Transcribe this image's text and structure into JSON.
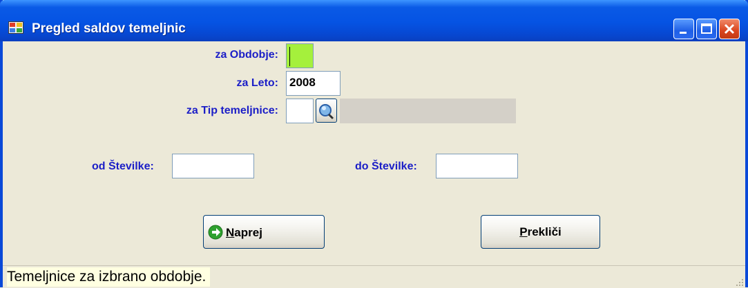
{
  "window": {
    "title": "Pregled saldov temeljnic",
    "minimize_label": "_",
    "maximize_label": "□",
    "close_label": "X"
  },
  "form": {
    "obdobje": {
      "label": "za Obdobje:",
      "value": ""
    },
    "leto": {
      "label": "za Leto:",
      "value": "2008"
    },
    "tip": {
      "label": "za Tip temeljnice:",
      "value": "",
      "description": ""
    },
    "od": {
      "label": "od Številke:",
      "value": ""
    },
    "do": {
      "label": "do Številke:",
      "value": ""
    }
  },
  "buttons": {
    "naprej": {
      "mnemonic": "N",
      "rest": "aprej"
    },
    "preklici": {
      "mnemonic": "P",
      "rest": "rekliči"
    }
  },
  "status": {
    "text": "Temeljnice za izbrano obdobje."
  },
  "colors": {
    "label": "#1b1ec7",
    "active_field": "#a5f03c",
    "titlebar": "#0553e3"
  }
}
